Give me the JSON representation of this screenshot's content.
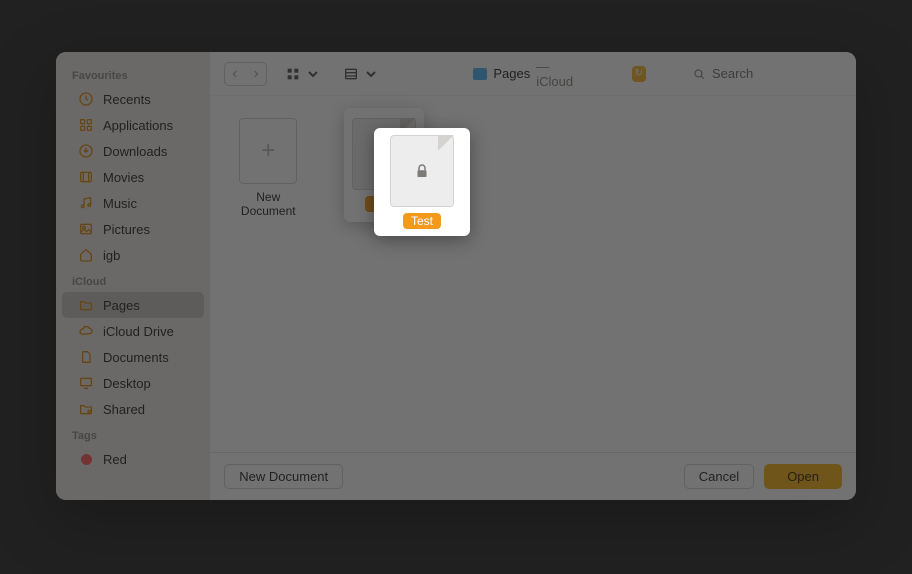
{
  "sidebar": {
    "sections": [
      {
        "title": "Favourites",
        "items": [
          {
            "icon": "clock",
            "label": "Recents"
          },
          {
            "icon": "grid",
            "label": "Applications"
          },
          {
            "icon": "down",
            "label": "Downloads"
          },
          {
            "icon": "film",
            "label": "Movies"
          },
          {
            "icon": "music",
            "label": "Music"
          },
          {
            "icon": "photo",
            "label": "Pictures"
          },
          {
            "icon": "house",
            "label": "igb"
          }
        ]
      },
      {
        "title": "iCloud",
        "items": [
          {
            "icon": "folder",
            "label": "Pages",
            "selected": true
          },
          {
            "icon": "cloud",
            "label": "iCloud Drive"
          },
          {
            "icon": "doc",
            "label": "Documents"
          },
          {
            "icon": "desk",
            "label": "Desktop"
          },
          {
            "icon": "share",
            "label": "Shared"
          }
        ]
      },
      {
        "title": "Tags",
        "items": [
          {
            "icon": "tagdot",
            "label": "Red"
          }
        ]
      }
    ]
  },
  "toolbar": {
    "location_main": "Pages",
    "location_sub": " — iCloud",
    "search_placeholder": "Search"
  },
  "files": {
    "new_document_label": "New Document",
    "selected_file_label": "Test"
  },
  "footer": {
    "new_doc": "New Document",
    "cancel": "Cancel",
    "open": "Open"
  }
}
